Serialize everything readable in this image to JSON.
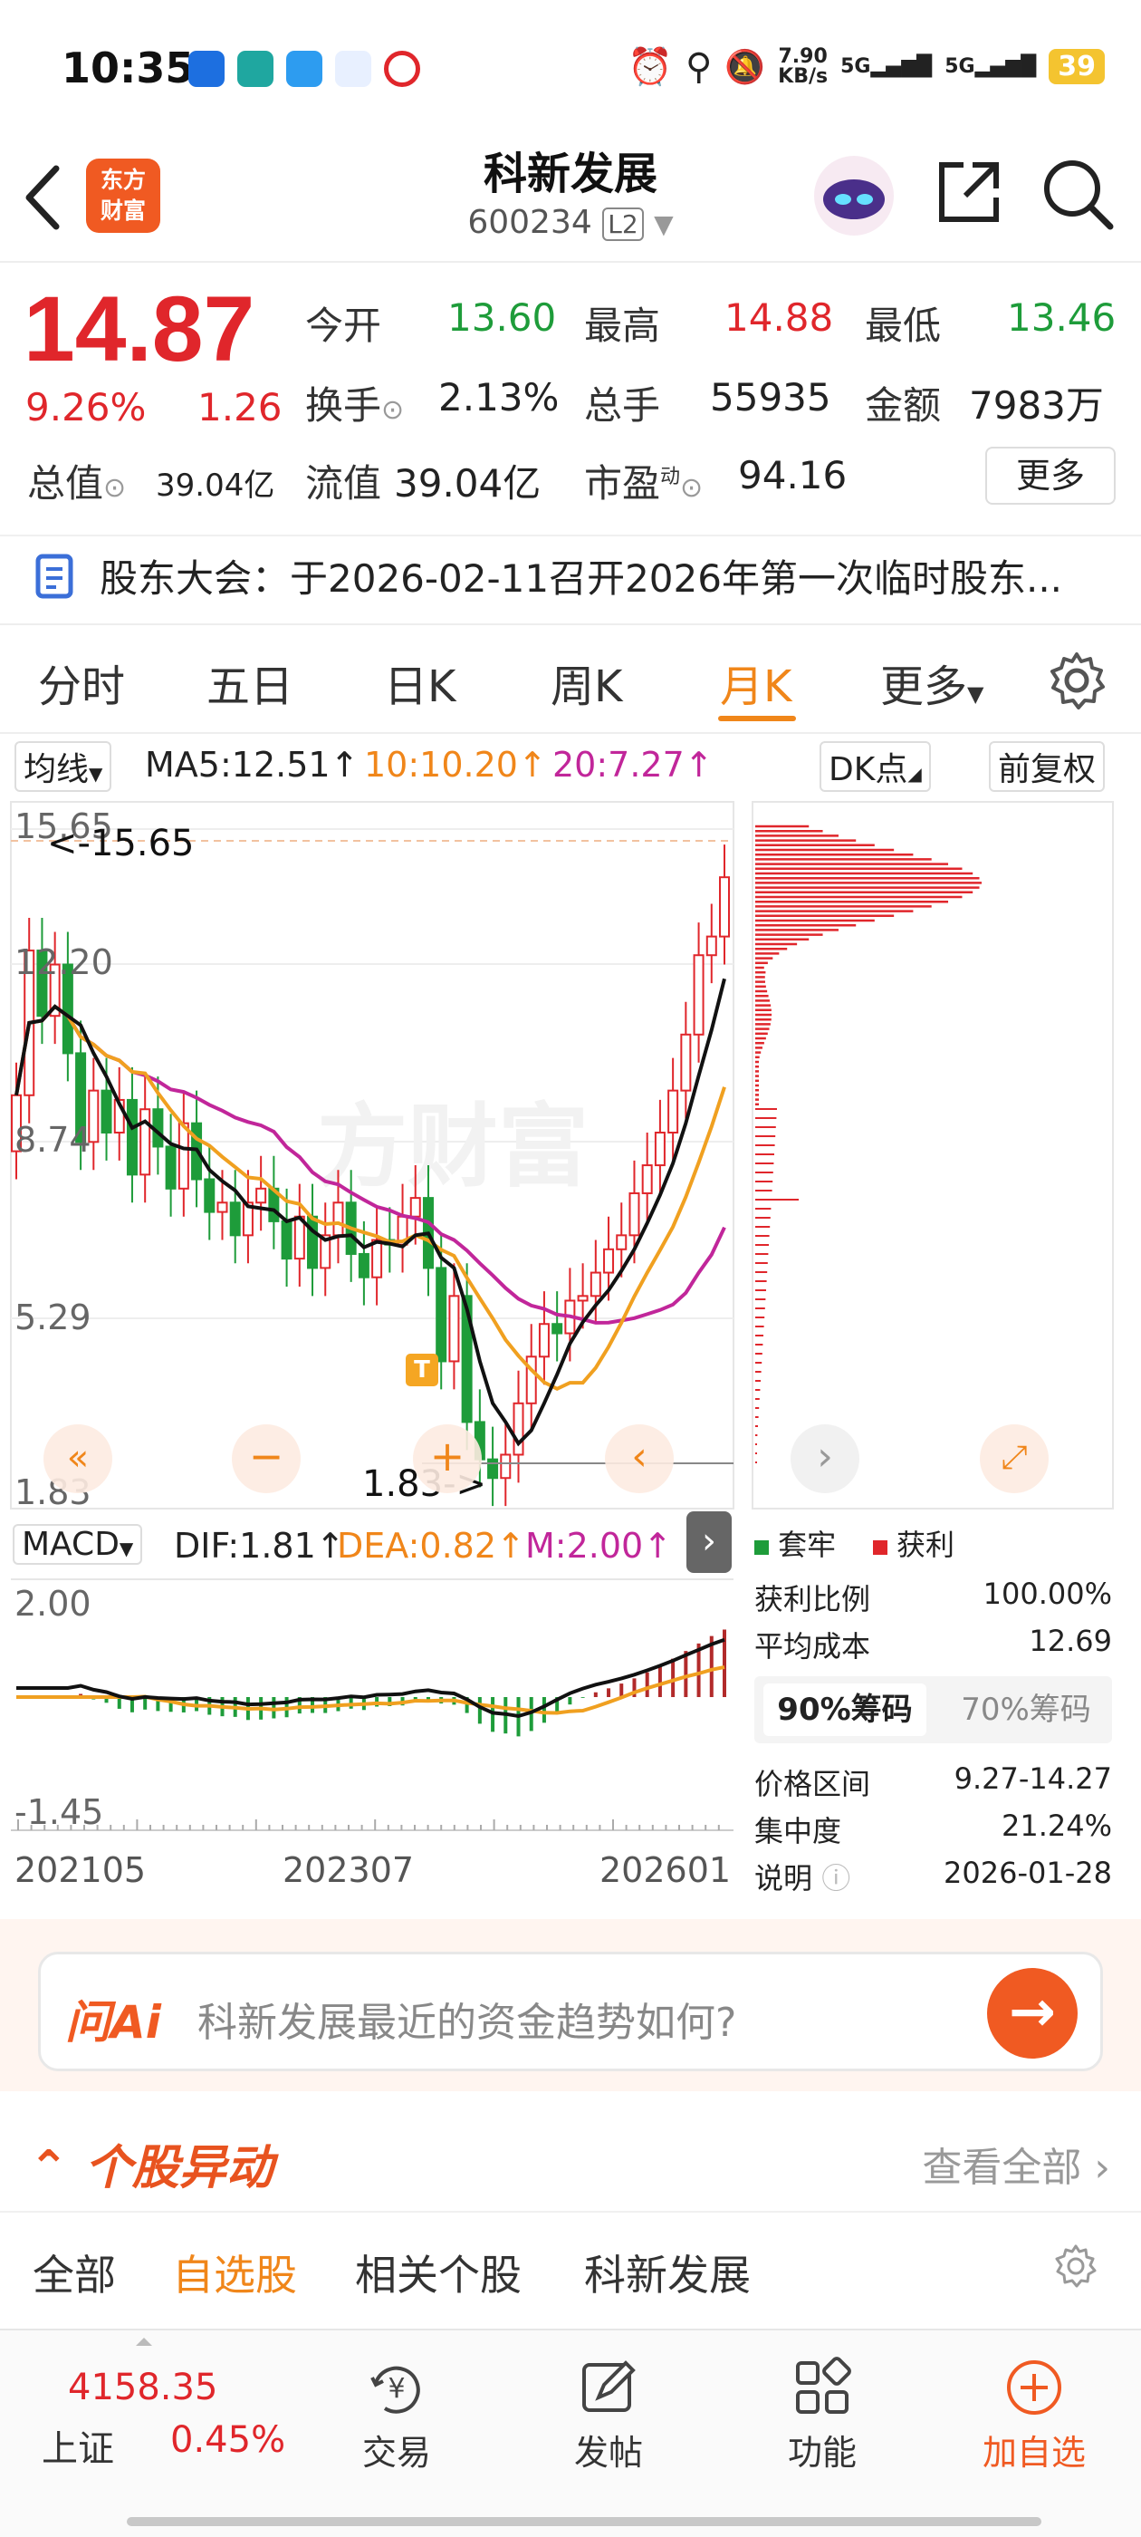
{
  "status": {
    "time": "10:35",
    "net_speed": "7.90",
    "net_unit": "KB/s",
    "sig1": "5G",
    "sig2": "5G",
    "battery": "39"
  },
  "header": {
    "logo_line1": "东方",
    "logo_line2": "财富",
    "title": "科新发展",
    "code": "600234",
    "level": "L2"
  },
  "quote": {
    "price": "14.87",
    "change_pct": "9.26%",
    "change_amt": "1.26",
    "open_label": "今开",
    "open": "13.60",
    "high_label": "最高",
    "high": "14.88",
    "low_label": "最低",
    "low": "13.46",
    "turnover_label": "换手",
    "turnover": "2.13%",
    "volume_label": "总手",
    "volume": "55935",
    "amount_label": "金额",
    "amount": "7983万",
    "mcap_label": "总值",
    "mcap": "39.04亿",
    "float_label": "流值",
    "float": "39.04亿",
    "pe_label": "市盈",
    "pe_sup": "动",
    "pe": "94.16",
    "more_label": "更多"
  },
  "notice": {
    "text": "股东大会：于2026-02-11召开2026年第一次临时股东..."
  },
  "tabs": [
    "分时",
    "五日",
    "日K",
    "周K",
    "月K",
    "更多"
  ],
  "active_tab": "月K",
  "ma": {
    "selector": "均线",
    "ma5": "MA5:12.51",
    "ma10": "10:10.20",
    "ma20": "20:7.27",
    "dk": "DK点",
    "adjust": "前复权"
  },
  "kchart": {
    "y_labels": [
      "15.65",
      "12.20",
      "8.74",
      "5.29",
      "1.83"
    ],
    "max_marker": "<-15.65",
    "min_marker": "1.83->",
    "t_badge": "T",
    "colors": {
      "up": "#e0262b",
      "down": "#1e9c3a",
      "ma5": "#111111",
      "ma10": "#f0a020",
      "ma20": "#c1269a"
    }
  },
  "macd": {
    "selector": "MACD",
    "dif": "DIF:1.81",
    "dea": "DEA:0.82",
    "m": "M:2.00",
    "y_top": "2.00",
    "y_bottom": "-1.45",
    "x_labels": [
      "202105",
      "202307",
      "202601"
    ]
  },
  "chips": {
    "legend_locked": "套牢",
    "legend_profit": "获利",
    "rows": [
      {
        "label": "获利比例",
        "value": "100.00%"
      },
      {
        "label": "平均成本",
        "value": "12.69"
      }
    ],
    "tab90": "90%筹码",
    "tab70": "70%筹码",
    "rows2": [
      {
        "label": "价格区间",
        "value": "9.27-14.27"
      },
      {
        "label": "集中度",
        "value": "21.24%"
      },
      {
        "label": "说明",
        "value": "2026-01-28"
      }
    ]
  },
  "ai": {
    "logo": "问Ai",
    "placeholder": "科新发展最近的资金趋势如何?"
  },
  "movers": {
    "title": "个股异动",
    "see_all": "查看全部",
    "tabs": [
      "全部",
      "自选股",
      "相关个股",
      "科新发展"
    ],
    "active": "自选股"
  },
  "bottom": {
    "index_value": "4158.35",
    "index_name": "上证",
    "index_pct": "0.45%",
    "items": [
      "交易",
      "发帖",
      "功能",
      "加自选"
    ]
  }
}
